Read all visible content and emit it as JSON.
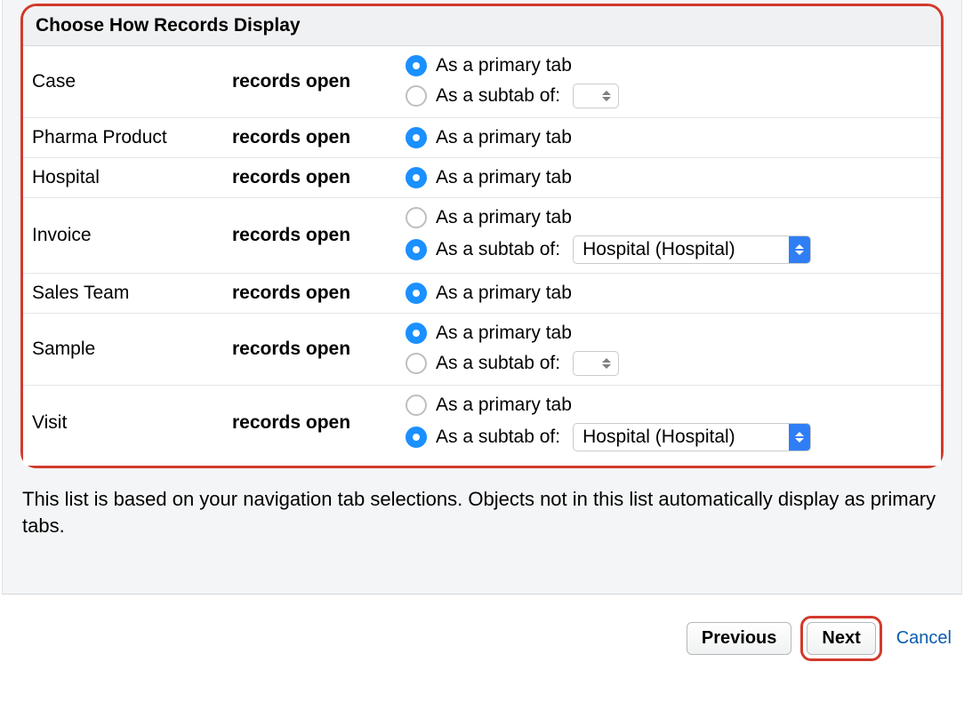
{
  "section_title": "Choose How Records Display",
  "records_open_label": "records open",
  "option_primary": "As a primary tab",
  "option_subtab": "As a subtab of:",
  "rows": [
    {
      "object": "Case",
      "options": [
        {
          "type": "primary",
          "selected": true
        },
        {
          "type": "subtab",
          "selected": false,
          "select_value": ""
        }
      ]
    },
    {
      "object": "Pharma Product",
      "options": [
        {
          "type": "primary",
          "selected": true
        }
      ]
    },
    {
      "object": "Hospital",
      "options": [
        {
          "type": "primary",
          "selected": true
        }
      ]
    },
    {
      "object": "Invoice",
      "options": [
        {
          "type": "primary",
          "selected": false
        },
        {
          "type": "subtab",
          "selected": true,
          "select_value": "Hospital (Hospital)"
        }
      ]
    },
    {
      "object": "Sales Team",
      "options": [
        {
          "type": "primary",
          "selected": true
        }
      ]
    },
    {
      "object": "Sample",
      "options": [
        {
          "type": "primary",
          "selected": true
        },
        {
          "type": "subtab",
          "selected": false,
          "select_value": ""
        }
      ]
    },
    {
      "object": "Visit",
      "options": [
        {
          "type": "primary",
          "selected": false
        },
        {
          "type": "subtab",
          "selected": true,
          "select_value": "Hospital (Hospital)"
        }
      ]
    }
  ],
  "description": "This list is based on your navigation tab selections. Objects not in this list automatically display as primary tabs.",
  "buttons": {
    "previous": "Previous",
    "next": "Next",
    "cancel": "Cancel"
  }
}
